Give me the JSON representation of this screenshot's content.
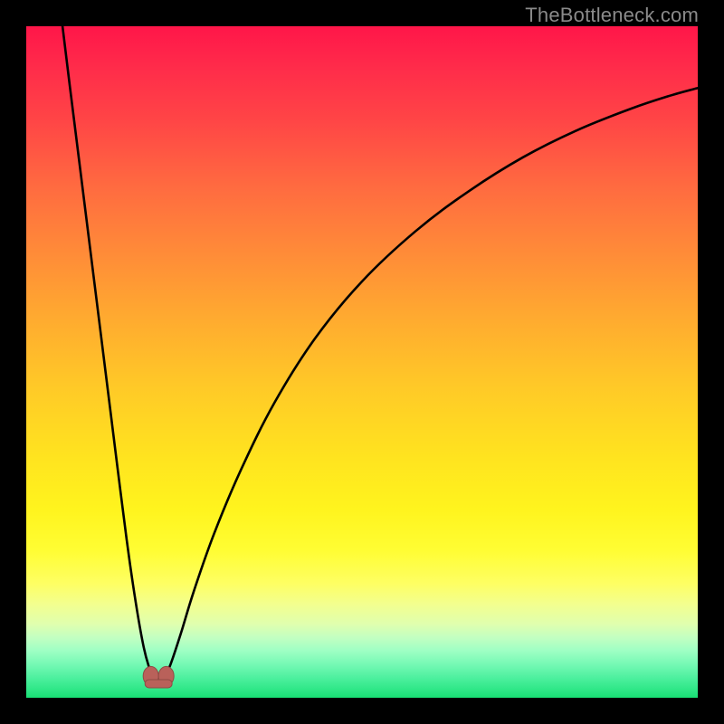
{
  "watermark": "TheBottleneck.com",
  "chart_data": {
    "type": "line",
    "title": "",
    "xlabel": "",
    "ylabel": "",
    "xlim": [
      0,
      100
    ],
    "ylim": [
      0,
      100
    ],
    "grid": false,
    "legend": false,
    "background_gradient": {
      "orientation": "vertical",
      "stops": [
        {
          "y": 0,
          "color": "#ff1649"
        },
        {
          "y": 30,
          "color": "#ff7a3b"
        },
        {
          "y": 55,
          "color": "#ffd324"
        },
        {
          "y": 78,
          "color": "#fffd33"
        },
        {
          "y": 90,
          "color": "#caffbe"
        },
        {
          "y": 100,
          "color": "#18e074"
        }
      ]
    },
    "series": [
      {
        "name": "left-branch",
        "x": [
          5.4,
          6.5,
          8.0,
          9.5,
          11.0,
          12.5,
          14.0,
          15.3,
          16.5,
          17.5,
          18.3,
          18.9
        ],
        "y": [
          0.0,
          9.0,
          21.0,
          33.0,
          45.0,
          57.0,
          69.0,
          79.0,
          87.0,
          92.5,
          95.5,
          97.0
        ]
      },
      {
        "name": "right-branch",
        "x": [
          20.6,
          21.5,
          23.0,
          25.0,
          28.0,
          32.0,
          37.0,
          43.0,
          50.0,
          58.0,
          66.0,
          74.0,
          82.0,
          90.0,
          96.0,
          100.0
        ],
        "y": [
          97.0,
          95.0,
          90.5,
          84.0,
          75.5,
          66.0,
          56.0,
          46.5,
          38.0,
          30.5,
          24.5,
          19.5,
          15.5,
          12.3,
          10.3,
          9.2
        ]
      }
    ],
    "marker": {
      "name": "cusp-marker",
      "x": 19.7,
      "y": 97.3,
      "shape": "u-lobed",
      "fill": "#b9615a",
      "stroke": "#8f4a44"
    }
  }
}
